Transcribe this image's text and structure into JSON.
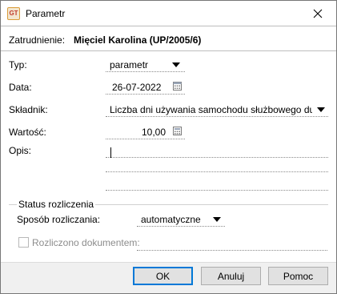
{
  "window": {
    "title": "Parametr",
    "app_icon_text": "GT"
  },
  "header": {
    "employee_label": "Zatrudnienie:",
    "employee_value": "Mięciel Karolina (UP/2005/6)"
  },
  "form": {
    "type_label": "Typ:",
    "type_value": "parametr",
    "date_label": "Data:",
    "date_value": "26-07-2022",
    "component_label": "Składnik:",
    "component_value": "Liczba dni używania samochodu służbowego dużego :",
    "value_label": "Wartość:",
    "value_value": "10,00",
    "description_label": "Opis:",
    "description_value": ""
  },
  "settlement": {
    "group_title": "Status rozliczenia",
    "method_label": "Sposób rozliczania:",
    "method_value": "automatyczne",
    "settled_by_doc_label": "Rozliczono dokumentem:",
    "settled_by_doc_checked": false,
    "settled_by_doc_value": ""
  },
  "buttons": {
    "ok_label": "OK",
    "cancel_label": "Anuluj",
    "help_label": "Pomoc"
  },
  "colors": {
    "default_button_border": "#0078d7",
    "footer_bg": "#f0f0f0",
    "disabled_text": "#8c8c8c"
  }
}
